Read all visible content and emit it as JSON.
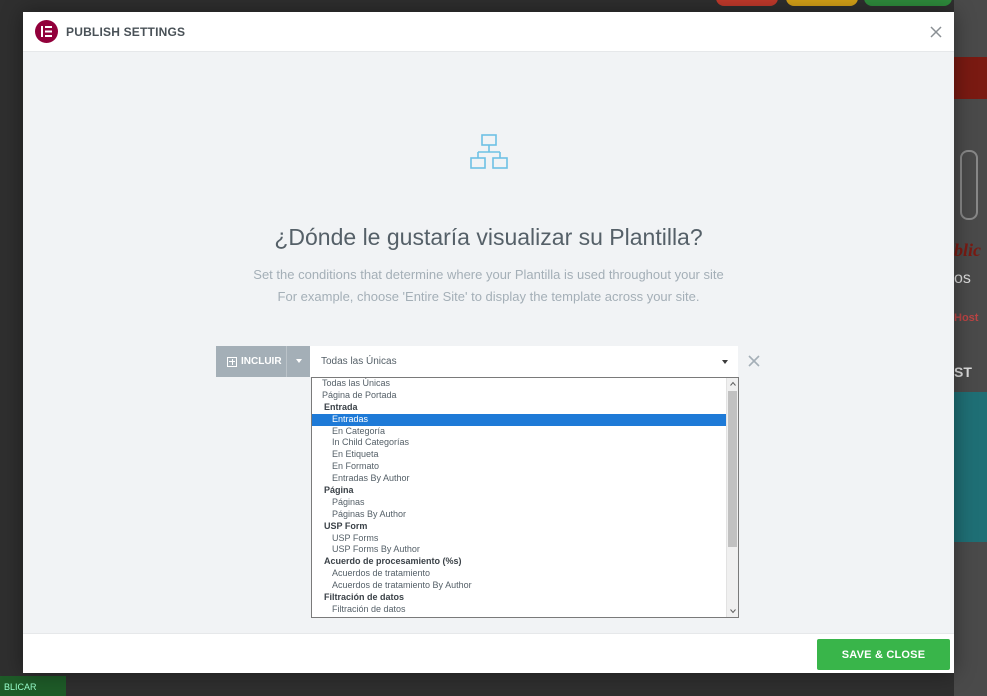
{
  "modal": {
    "title": "PUBLISH SETTINGS",
    "heading": "¿Dónde le gustaría visualizar su Plantilla?",
    "description_line1": "Set the conditions that determine where your Plantilla is used throughout your site",
    "description_line2": "For example, choose 'Entire Site' to display the template across your site."
  },
  "condition": {
    "type_label": "INCLUIR",
    "selected_value": "Todas las Únicas"
  },
  "dropdown": {
    "options": [
      {
        "label": "Todas las Únicas",
        "kind": "lvl0"
      },
      {
        "label": "Página de Portada",
        "kind": "lvl0"
      },
      {
        "label": "Entrada",
        "kind": "grp"
      },
      {
        "label": "Entradas",
        "kind": "lvl1",
        "selected": true
      },
      {
        "label": "En Categoría",
        "kind": "lvl1"
      },
      {
        "label": "In Child Categorías",
        "kind": "lvl1"
      },
      {
        "label": "En Etiqueta",
        "kind": "lvl1"
      },
      {
        "label": "En Formato",
        "kind": "lvl1"
      },
      {
        "label": "Entradas By Author",
        "kind": "lvl1"
      },
      {
        "label": "Página",
        "kind": "grp"
      },
      {
        "label": "Páginas",
        "kind": "lvl1"
      },
      {
        "label": "Páginas By Author",
        "kind": "lvl1"
      },
      {
        "label": "USP Form",
        "kind": "grp"
      },
      {
        "label": "USP Forms",
        "kind": "lvl1"
      },
      {
        "label": "USP Forms By Author",
        "kind": "lvl1"
      },
      {
        "label": "Acuerdo de procesamiento (%s)",
        "kind": "grp"
      },
      {
        "label": "Acuerdos de tratamiento",
        "kind": "lvl1"
      },
      {
        "label": "Acuerdos de tratamiento By Author",
        "kind": "lvl1"
      },
      {
        "label": "Filtración de datos",
        "kind": "grp"
      },
      {
        "label": "Filtración de datos",
        "kind": "lvl1"
      }
    ]
  },
  "footer": {
    "save_label": "SAVE & CLOSE"
  },
  "background": {
    "fragment_1": "blic",
    "fragment_2": "os",
    "fragment_3": "Host",
    "fragment_4": "ST",
    "bottom_button": "BLICAR"
  },
  "colors": {
    "brand": "#92003b",
    "accent_green": "#39b54a",
    "selection_blue": "#1e7ad7",
    "muted_gray": "#a4afb7"
  },
  "icons": {
    "logo": "elementor-logo-icon",
    "hero": "sitemap-icon",
    "close": "close-icon",
    "remove": "close-icon"
  }
}
